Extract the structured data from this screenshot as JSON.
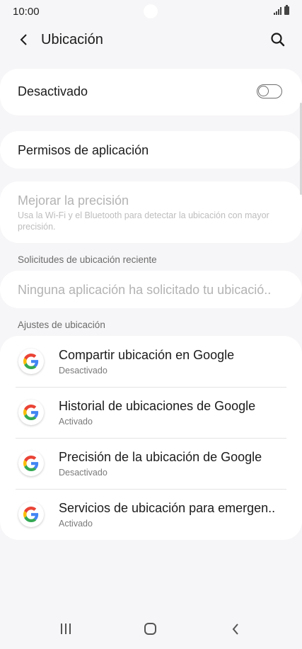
{
  "status_bar": {
    "time": "10:00"
  },
  "app_bar": {
    "title": "Ubicación"
  },
  "location_toggle": {
    "label": "Desactivado",
    "state": "off"
  },
  "app_permissions": {
    "label": "Permisos de aplicación"
  },
  "improve_accuracy": {
    "label": "Mejorar la precisión",
    "description": "Usa la Wi-Fi y el Bluetooth para detectar la ubicación con mayor precisión."
  },
  "recent_requests": {
    "header": "Solicitudes de ubicación reciente",
    "empty_text": "Ninguna aplicación ha solicitado tu ubicació.."
  },
  "location_settings": {
    "header": "Ajustes de ubicación",
    "items": [
      {
        "title": "Compartir ubicación en Google",
        "subtitle": "Desactivado",
        "icon": "google-icon"
      },
      {
        "title": "Historial de ubicaciones de Google",
        "subtitle": "Activado",
        "icon": "google-icon"
      },
      {
        "title": "Precisión de la ubicación de Google",
        "subtitle": "Desactivado",
        "icon": "google-icon"
      },
      {
        "title": "Servicios de ubicación para emergen..",
        "subtitle": "Activado",
        "icon": "google-icon"
      }
    ]
  },
  "colors": {
    "background": "#f6f5f7",
    "card": "#ffffff",
    "disabled_text": "#b3b3b3"
  }
}
